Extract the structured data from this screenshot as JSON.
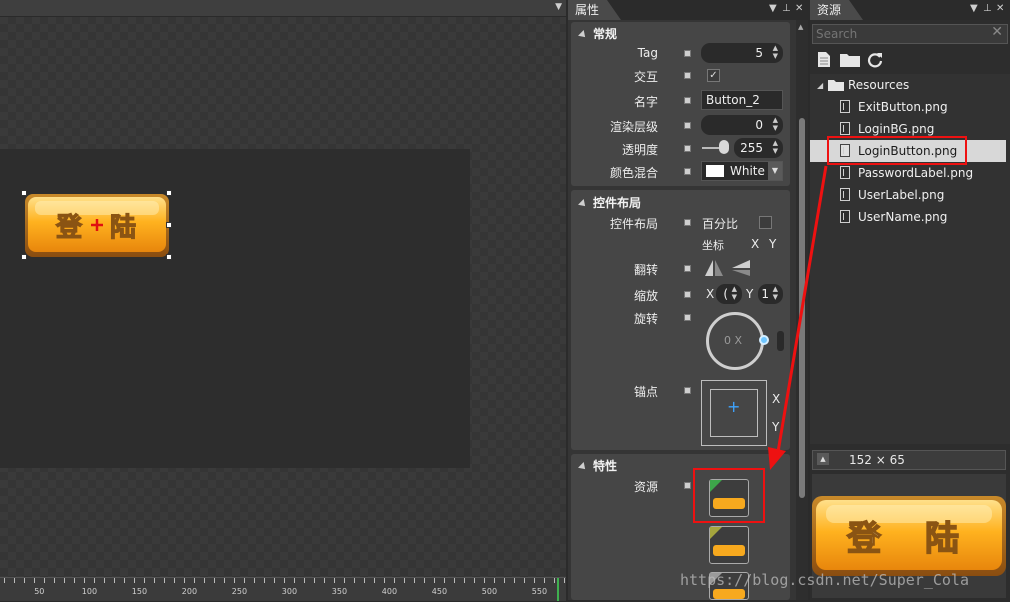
{
  "canvas": {
    "button_text": [
      "登",
      "陆"
    ],
    "ruler": [
      "50",
      "100",
      "150",
      "200",
      "250",
      "300",
      "350",
      "400",
      "450",
      "500",
      "550"
    ]
  },
  "properties": {
    "tab": "属性",
    "general": {
      "title": "常规",
      "tag_label": "Tag",
      "tag_value": "5",
      "interact_label": "交互",
      "interact_checked": "✓",
      "name_label": "名字",
      "name_value": "Button_2",
      "zorder_label": "渲染层级",
      "zorder_value": "0",
      "opacity_label": "透明度",
      "opacity_value": "255",
      "blend_label": "颜色混合",
      "blend_value": "White"
    },
    "layout": {
      "title": "控件布局",
      "layout_label": "控件布局",
      "percent_label": "百分比",
      "coord_label": "坐标",
      "x": "X",
      "y": "Y",
      "flip_label": "翻转",
      "scale_label": "缩放",
      "scale_x_value": "(",
      "scale_y_value": "1",
      "rotate_label": "旋转",
      "rotate_value": "0 X",
      "anchor_label": "锚点",
      "anchor_x": "X",
      "anchor_y": "Y"
    },
    "features": {
      "title": "特性",
      "resource_label": "资源"
    }
  },
  "resources": {
    "tab": "资源",
    "search_placeholder": "Search",
    "root": "Resources",
    "files": [
      "ExitButton.png",
      "LoginBG.png",
      "LoginButton.png",
      "PasswordLabel.png",
      "UserLabel.png",
      "UserName.png"
    ],
    "selected_file": "LoginButton.png",
    "preview_size": "152  ×  65",
    "preview_text": [
      "登",
      "陆"
    ]
  },
  "watermark": "https://blog.csdn.net/Super_Cola",
  "colors": {
    "highlight": "#ee1111",
    "selection": "#d8d8d8",
    "button_orange": "#f7a91e"
  }
}
